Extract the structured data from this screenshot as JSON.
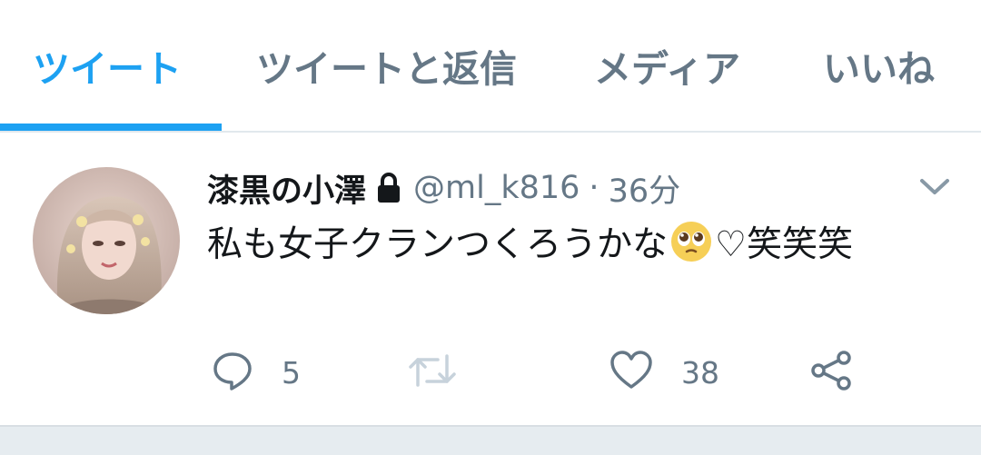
{
  "tabs": [
    {
      "label": "ツイート",
      "active": true
    },
    {
      "label": "ツイートと返信",
      "active": false
    },
    {
      "label": "メディア",
      "active": false
    },
    {
      "label": "いいね",
      "active": false
    }
  ],
  "tweet": {
    "display_name": "漆黒の小澤",
    "protected_icon": "lock-icon",
    "handle": "@ml_k816",
    "separator": "·",
    "time": "36分",
    "text_before_emoji": "私も女子クランつくろうかな",
    "emoji": "pleading-face-emoji",
    "text_after_emoji": "♡笑笑笑",
    "actions": {
      "reply_count": "5",
      "retweet_count": "",
      "like_count": "38"
    }
  },
  "colors": {
    "accent": "#1da1f2",
    "secondary_text": "#657786",
    "primary_text": "#14171a",
    "divider": "#e1e8ed"
  }
}
